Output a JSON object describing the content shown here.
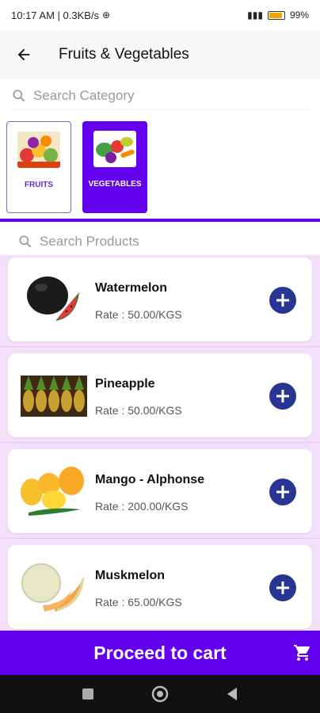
{
  "status_bar": {
    "time_info": "10:17 AM | 0.3KB/s",
    "battery": "99",
    "battery_level": 0.99
  },
  "app_bar": {
    "title": "Fruits & Vegetables",
    "back_icon": "arrow-left-icon"
  },
  "category_search": {
    "placeholder": "Search Category"
  },
  "categories": [
    {
      "label": "FRUITS",
      "selected": false
    },
    {
      "label": "VEGETABLES",
      "selected": true
    }
  ],
  "product_search": {
    "placeholder": "Search Products"
  },
  "products": [
    {
      "name": "Watermelon",
      "rate": "Rate : 50.00/KGS",
      "icon": "watermelon-image"
    },
    {
      "name": "Pineapple",
      "rate": "Rate : 50.00/KGS",
      "icon": "pineapple-image"
    },
    {
      "name": "Mango - Alphonse",
      "rate": "Rate : 200.00/KGS",
      "icon": "mango-image"
    },
    {
      "name": "Muskmelon",
      "rate": "Rate : 65.00/KGS",
      "icon": "muskmelon-image"
    }
  ],
  "footer": {
    "proceed_label": "Proceed to cart",
    "cart_icon": "cart-icon"
  },
  "colors": {
    "primary": "#6200ee",
    "add_button": "#283593",
    "list_background": "#f3dff9"
  }
}
